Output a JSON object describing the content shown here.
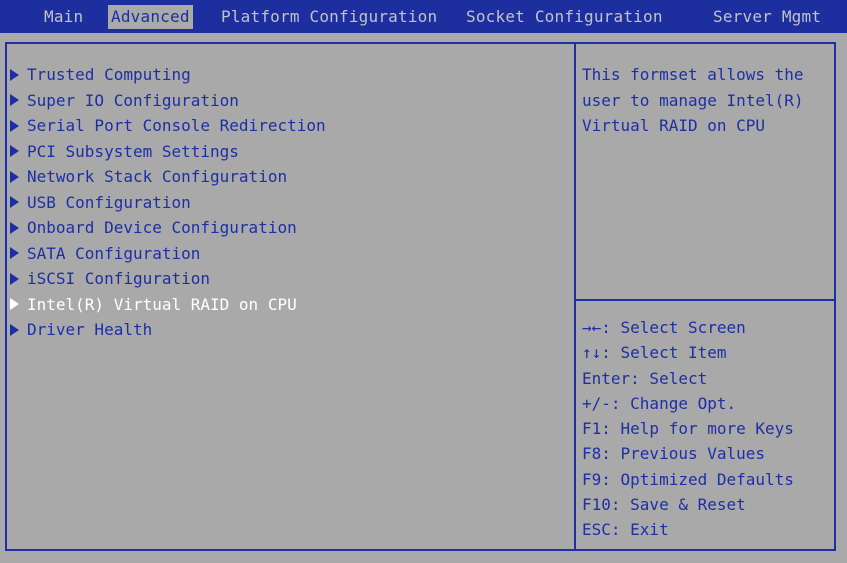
{
  "tabs": [
    {
      "label": "Main",
      "active": false
    },
    {
      "label": "Advanced",
      "active": true
    },
    {
      "label": "Platform Configuration",
      "active": false
    },
    {
      "label": "Socket Configuration",
      "active": false
    },
    {
      "label": "Server Mgmt",
      "active": false
    }
  ],
  "menu": {
    "items": [
      {
        "label": "Trusted Computing"
      },
      {
        "label": "Super IO Configuration"
      },
      {
        "label": "Serial Port Console Redirection"
      },
      {
        "label": "PCI Subsystem Settings"
      },
      {
        "label": "Network Stack Configuration"
      },
      {
        "label": "USB Configuration"
      },
      {
        "label": "Onboard Device Configuration"
      },
      {
        "label": "SATA Configuration"
      },
      {
        "label": "iSCSI Configuration"
      },
      {
        "label": "Intel(R) Virtual RAID on CPU",
        "selected": true
      },
      {
        "label": "Driver Health"
      }
    ]
  },
  "help": {
    "text": "This formset allows the user to manage Intel(R) Virtual RAID on CPU"
  },
  "keys": [
    "→←: Select Screen",
    "↑↓: Select Item",
    "Enter: Select",
    "+/-: Change Opt.",
    "F1: Help for more Keys",
    "F8: Previous Values",
    "F9: Optimized Defaults",
    "F10: Save & Reset",
    "ESC: Exit"
  ],
  "colors": {
    "background": "#a9a9a9",
    "accent_blue": "#1d2fa6",
    "selected_text": "#ffffff",
    "inactive_tab_text": "#c3c3c3"
  }
}
